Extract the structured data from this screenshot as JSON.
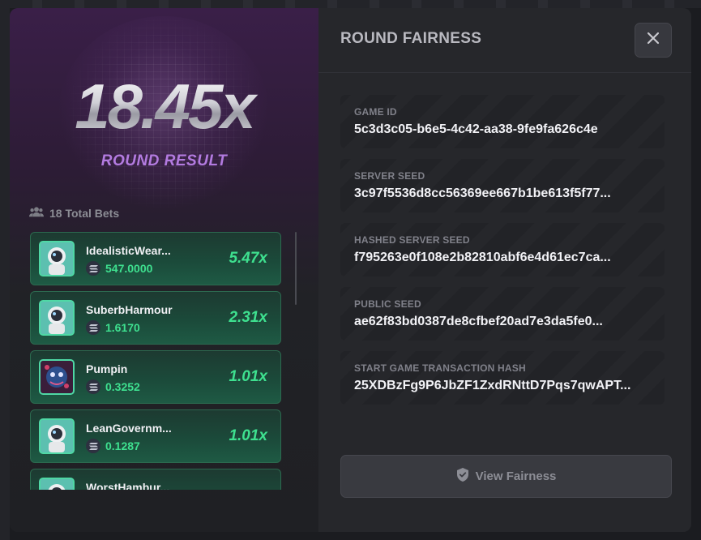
{
  "round": {
    "multiplier": "18.45x",
    "label": "ROUND RESULT"
  },
  "bets": {
    "total_label": "18 Total Bets",
    "items": [
      {
        "name": "IdealisticWear...",
        "amount": "547.0000",
        "multiplier": "5.47x",
        "avatar": "astronaut"
      },
      {
        "name": "SuberbHarmour",
        "amount": "1.6170",
        "multiplier": "2.31x",
        "avatar": "astronaut"
      },
      {
        "name": "Pumpin",
        "amount": "0.3252",
        "multiplier": "1.01x",
        "avatar": "creature"
      },
      {
        "name": "LeanGovernm...",
        "amount": "0.1287",
        "multiplier": "1.01x",
        "avatar": "astronaut"
      },
      {
        "name": "WorstHambur...",
        "amount": "",
        "multiplier": "",
        "avatar": "astronaut"
      }
    ]
  },
  "fairness": {
    "title": "ROUND FAIRNESS",
    "fields": [
      {
        "label": "GAME ID",
        "value": "5c3d3c05-b6e5-4c42-aa38-9fe9fa626c4e"
      },
      {
        "label": "SERVER SEED",
        "value": "3c97f5536d8cc56369ee667b1be613f5f77..."
      },
      {
        "label": "HASHED SERVER SEED",
        "value": "f795263e0f108e2b82810abf6e4d61ec7ca..."
      },
      {
        "label": "PUBLIC SEED",
        "value": "ae62f83bd0387de8cfbef20ad7e3da5fe0..."
      },
      {
        "label": "START GAME TRANSACTION HASH",
        "value": "25XDBzFg9P6JbZF1ZxdRNttD7Pqs7qwAPT..."
      }
    ],
    "button_label": "View Fairness"
  },
  "icons": {
    "close": "close-icon",
    "users": "users-icon",
    "shield": "shield-check-icon",
    "currency": "solana-icon"
  },
  "colors": {
    "accent_green": "#3ee08f",
    "accent_purple": "#b37be0",
    "panel": "#26272b"
  }
}
